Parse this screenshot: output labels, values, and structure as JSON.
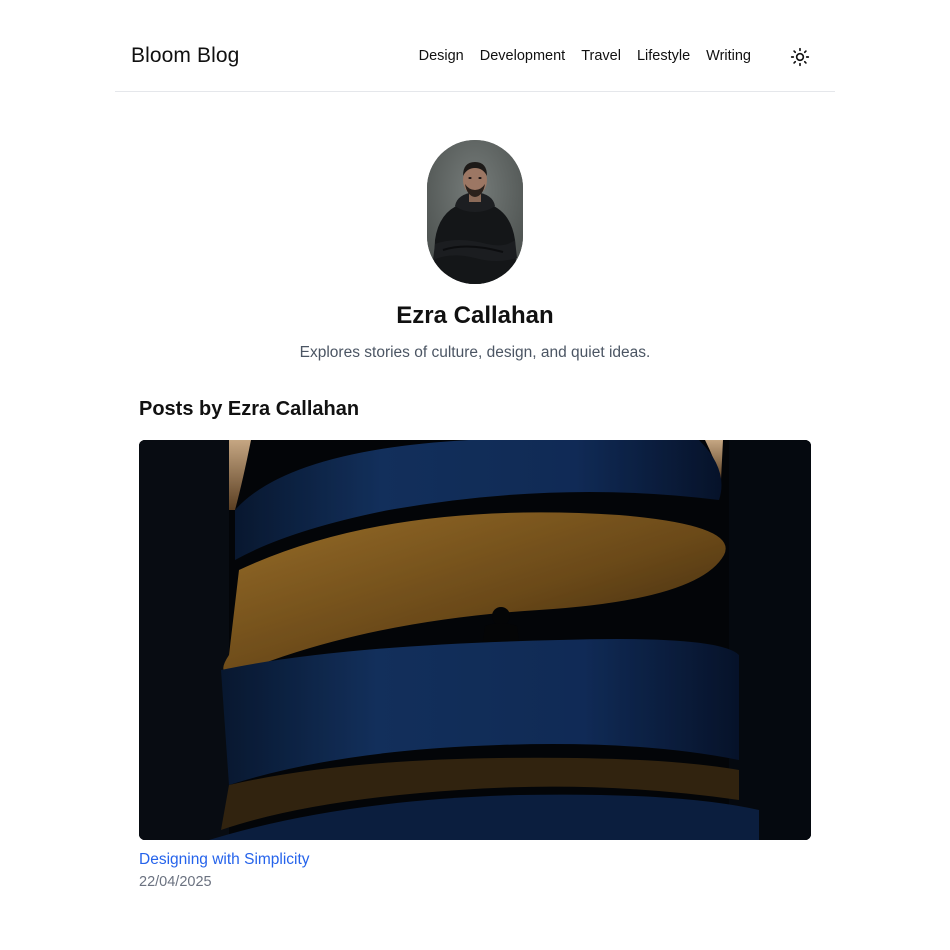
{
  "site": {
    "logo": "Bloom Blog"
  },
  "nav": {
    "items": [
      {
        "label": "Design"
      },
      {
        "label": "Development"
      },
      {
        "label": "Travel"
      },
      {
        "label": "Lifestyle"
      },
      {
        "label": "Writing"
      }
    ]
  },
  "theme_toggle": {
    "icon": "sun-icon"
  },
  "author": {
    "name": "Ezra Callahan",
    "bio": "Explores stories of culture, design, and quiet ideas."
  },
  "posts": {
    "heading": "Posts by Ezra Callahan",
    "items": [
      {
        "title": "Designing with Simplicity",
        "date": "22/04/2025"
      }
    ]
  },
  "colors": {
    "link": "#2563eb",
    "muted_text": "#6b7280",
    "border": "#e5e7eb"
  }
}
